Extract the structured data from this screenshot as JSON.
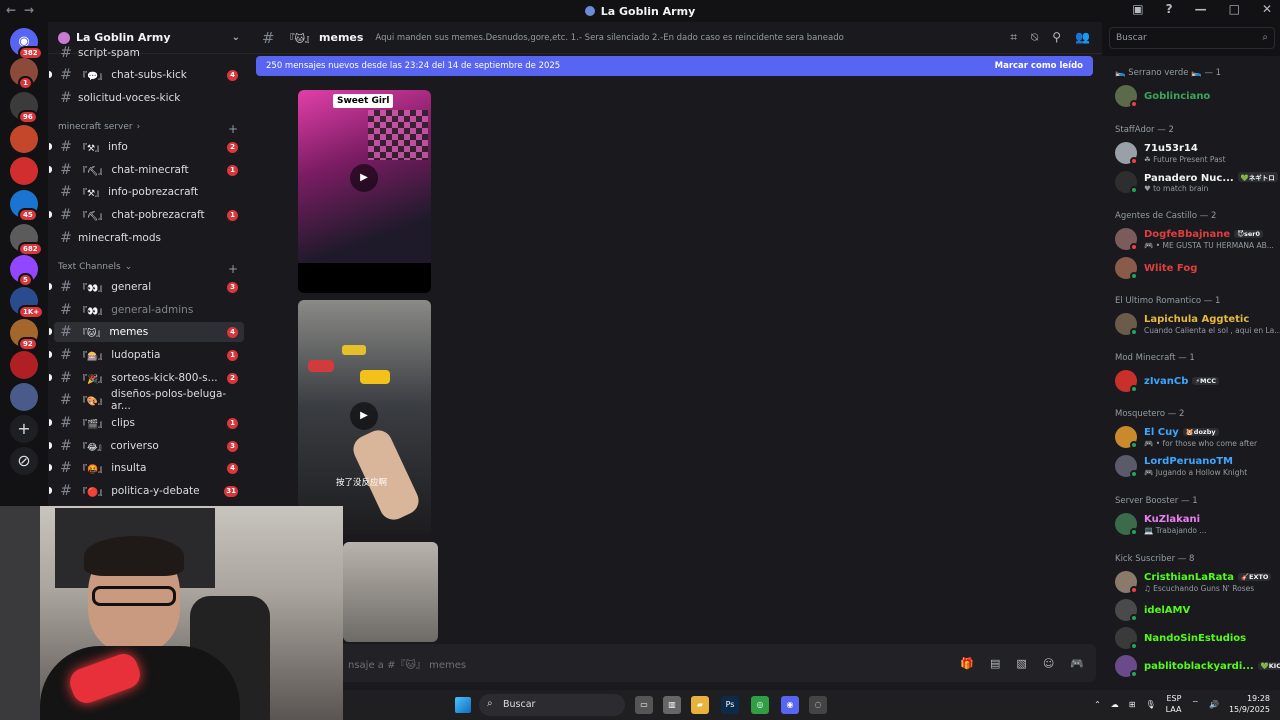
{
  "window": {
    "title": "La Goblin Army"
  },
  "rail": {
    "servers": [
      {
        "name": "discord-home",
        "color": "#5865f2",
        "badge": "382",
        "glyph": "◉"
      },
      {
        "name": "server-2",
        "color": "#8b4a3a",
        "badge": "1"
      },
      {
        "name": "server-3",
        "color": "#3b3b3b",
        "badge": "96"
      },
      {
        "name": "server-4",
        "color": "#c4472c",
        "badge": ""
      },
      {
        "name": "server-5",
        "color": "#d12f2f",
        "badge": ""
      },
      {
        "name": "server-6",
        "color": "#1b75d0",
        "badge": "45"
      },
      {
        "name": "server-7",
        "color": "#5b5b5b",
        "badge": "682"
      },
      {
        "name": "server-8",
        "color": "#9146ff",
        "badge": "5"
      },
      {
        "name": "server-9",
        "color": "#2a4c8f",
        "badge": "1K+"
      },
      {
        "name": "server-10",
        "color": "#a3662b",
        "badge": "92"
      },
      {
        "name": "server-11",
        "color": "#b01f24",
        "badge": ""
      },
      {
        "name": "server-12",
        "color": "#4a5a8a",
        "badge": ""
      }
    ],
    "add_glyph": "+",
    "explore_glyph": "⊘"
  },
  "sidebar": {
    "server_name": "La Goblin Army",
    "channels_top": [
      {
        "emoji": "",
        "label": "script-spam",
        "badge": ""
      },
      {
        "emoji": "『💬』",
        "label": "chat-subs-kick",
        "badge": "4"
      },
      {
        "emoji": "",
        "label": "solicitud-voces-kick",
        "badge": ""
      }
    ],
    "cat_minecraft": "minecraft server",
    "channels_mc": [
      {
        "emoji": "『⚒』",
        "label": "info",
        "badge": "2"
      },
      {
        "emoji": "『⛏』",
        "label": "chat-minecraft",
        "badge": "1"
      },
      {
        "emoji": "『⚒』",
        "label": "info-pobrezacraft",
        "badge": ""
      },
      {
        "emoji": "『⛏』",
        "label": "chat-pobrezacraft",
        "badge": "1"
      },
      {
        "emoji": "",
        "label": "minecraft-mods",
        "badge": ""
      }
    ],
    "cat_text": "Text Channels",
    "channels_text": [
      {
        "emoji": "『👀』",
        "label": "general",
        "badge": "3",
        "state": ""
      },
      {
        "emoji": "『👀』",
        "label": "general-admins",
        "badge": "",
        "state": "muted"
      },
      {
        "emoji": "『🐱』",
        "label": "memes",
        "badge": "4",
        "state": "active"
      },
      {
        "emoji": "『🎰』",
        "label": "ludopatia",
        "badge": "1",
        "state": ""
      },
      {
        "emoji": "『🎉』",
        "label": "sorteos-kick-800-s...",
        "badge": "2",
        "state": ""
      },
      {
        "emoji": "『🎨』",
        "label": "diseños-polos-beluga-ar...",
        "badge": "",
        "state": ""
      },
      {
        "emoji": "『🎬』",
        "label": "clips",
        "badge": "1",
        "state": ""
      },
      {
        "emoji": "『😂』",
        "label": "coriverso",
        "badge": "3",
        "state": ""
      },
      {
        "emoji": "『🤬』",
        "label": "insulta",
        "badge": "4",
        "state": ""
      },
      {
        "emoji": "『🔴』",
        "label": "politica-y-debate",
        "badge": "31",
        "state": ""
      }
    ]
  },
  "chat": {
    "channel_emoji": "『🐱』",
    "channel_name": "memes",
    "topic": "Aqui manden sus memes.Desnudos,gore,etc. 1.- Sera silenciado 2.-En dado caso es reincidente sera baneado",
    "new_messages": "250 mensajes nuevos desde las 23:24 del 14 de septiembre de 2025",
    "mark_read": "Marcar como leído",
    "video1_caption": "Sweet Girl",
    "video2_caption": "按了没反应啊",
    "composer_placeholder": "nsaje a #『🐱』 memes"
  },
  "search": {
    "placeholder": "Buscar"
  },
  "members": {
    "groups": [
      {
        "role": "🛌 Serrano verde 🛌 — 1",
        "items": [
          {
            "name": "Goblinciano",
            "color": "#3ba55c",
            "sub": "",
            "tag": "",
            "status": "dnd",
            "av": "#5b6b4a"
          }
        ]
      },
      {
        "role": "StaffAdor — 2",
        "items": [
          {
            "name": "71u53r14",
            "color": "#f2f3f5",
            "sub": "☘ Future Present Past",
            "tag": "",
            "status": "dnd",
            "av": "#9aa0a8"
          },
          {
            "name": "Panadero Nuc...",
            "color": "#f2f3f5",
            "sub": "♥ to match brain",
            "tag": "💚ネギトロ",
            "status": "online",
            "av": "#2e2e2e"
          }
        ]
      },
      {
        "role": "Agentes de Castillo — 2",
        "items": [
          {
            "name": "DogfeBbajnane",
            "color": "#e03e3e",
            "sub": "🎮 • ME GUSTA TU HERMANA AB...",
            "tag": "😈ser0",
            "status": "dnd",
            "av": "#7c5b5b"
          },
          {
            "name": "Wlite Fog",
            "color": "#e03e3e",
            "sub": "",
            "tag": "",
            "status": "online",
            "av": "#8a5b4a"
          }
        ]
      },
      {
        "role": "El Ultimo Romantico — 1",
        "items": [
          {
            "name": "Lapichula Aggtetic",
            "color": "#e6b83c",
            "sub": "Cuando Calienta el sol , aqui en La...",
            "tag": "",
            "status": "online",
            "av": "#6b5b4a"
          }
        ]
      },
      {
        "role": "Mod Minecraft — 1",
        "items": [
          {
            "name": "zIvanCb",
            "color": "#3ea6ff",
            "sub": "",
            "tag": "⚡MCC",
            "status": "online",
            "av": "#c9302c"
          }
        ]
      },
      {
        "role": "Mosquetero — 2",
        "items": [
          {
            "name": "El Cuy",
            "color": "#3ea6ff",
            "sub": "🎮 • for those who come after",
            "tag": "🐹dozby",
            "status": "online",
            "av": "#c98a2c"
          },
          {
            "name": "LordPeruanoTM",
            "color": "#3ea6ff",
            "sub": "🎮 Jugando a Hollow Knight",
            "tag": "",
            "status": "online",
            "av": "#5a5a6a"
          }
        ]
      },
      {
        "role": "Server Booster — 1",
        "items": [
          {
            "name": "KuZlakani",
            "color": "#e880f2",
            "sub": "💻 Trabajando ...",
            "tag": "",
            "status": "online",
            "av": "#3b6b4a"
          }
        ]
      },
      {
        "role": "Kick Suscriber — 8",
        "items": [
          {
            "name": "CristhianLaRata",
            "color": "#53fc18",
            "sub": "♫ Escuchando Guns N' Roses",
            "tag": "🎸EXTO",
            "status": "dnd",
            "av": "#8a7a6a"
          },
          {
            "name": "idelAMV",
            "color": "#53fc18",
            "sub": "",
            "tag": "",
            "status": "online",
            "av": "#4a4a4a"
          },
          {
            "name": "NandoSinEstudios",
            "color": "#53fc18",
            "sub": "",
            "tag": "",
            "status": "online",
            "av": "#3a3a3a"
          },
          {
            "name": "pablitoblackyardi...",
            "color": "#53fc18",
            "sub": "",
            "tag": "💚KICK",
            "status": "online",
            "av": "#6a4a8a"
          }
        ]
      }
    ]
  },
  "taskbar": {
    "search_label": "Buscar",
    "lang": "ESP",
    "lang2": "LAA",
    "time": "19:28",
    "date": "15/9/2025",
    "apps": [
      {
        "name": "task-view",
        "color": "#555",
        "glyph": "▭"
      },
      {
        "name": "app-2",
        "color": "#666",
        "glyph": "▥"
      },
      {
        "name": "file-explorer",
        "color": "#e8b33c",
        "glyph": "▰"
      },
      {
        "name": "photoshop",
        "color": "#0c2a4a",
        "glyph": "Ps"
      },
      {
        "name": "chrome",
        "color": "#2f9e44",
        "glyph": "◎"
      },
      {
        "name": "discord",
        "color": "#5865f2",
        "glyph": "◉"
      },
      {
        "name": "app-7",
        "color": "#444",
        "glyph": "◌"
      }
    ]
  }
}
